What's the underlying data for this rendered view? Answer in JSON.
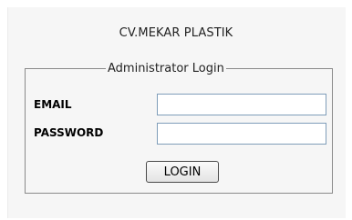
{
  "header": {
    "company_name": "CV.MEKAR PLASTIK"
  },
  "login_form": {
    "legend": "Administrator Login",
    "email_label": "EMAIL",
    "email_value": "",
    "password_label": "PASSWORD",
    "password_value": "",
    "submit_label": "LOGIN"
  }
}
